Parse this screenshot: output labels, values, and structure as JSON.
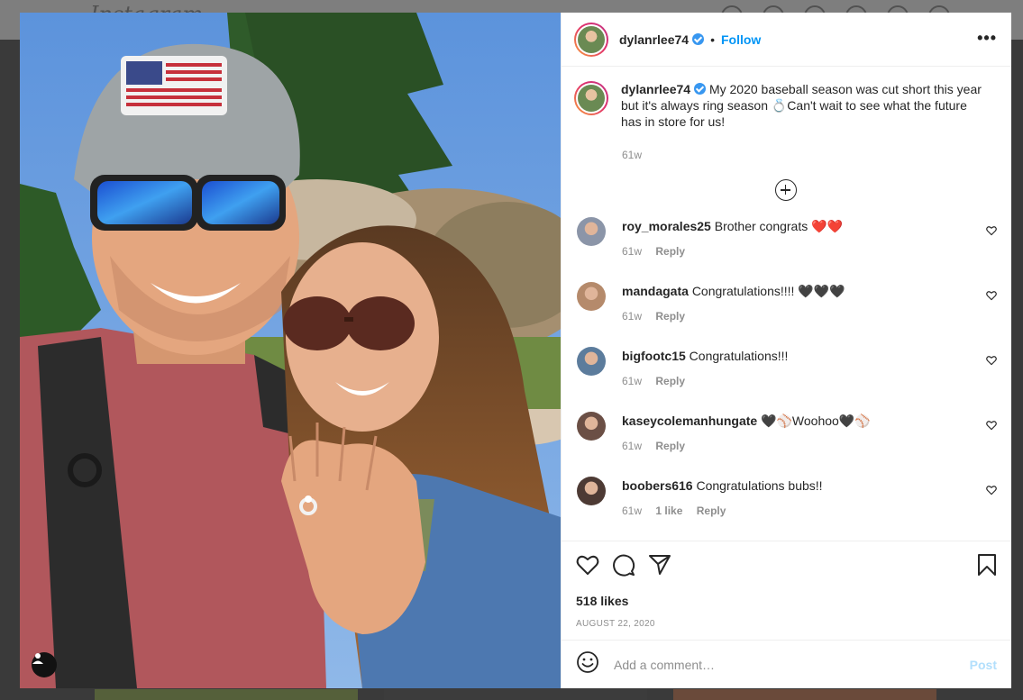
{
  "background": {
    "logo": "Instagram"
  },
  "post": {
    "author": "dylanrlee74",
    "separator": "•",
    "follow_label": "Follow",
    "more_label": "•••",
    "caption_author": "dylanrlee74",
    "caption_line1": "My 2020 baseball season was cut short this year",
    "caption_line2": "but it's always ring season 💍Can't wait to see what the future",
    "caption_line3": "has in store for us!",
    "caption_time": "61w",
    "likes": "518 likes",
    "date": "AUGUST 22, 2020"
  },
  "comments": [
    {
      "user": "roy_morales25",
      "text": "Brother congrats ❤️❤️",
      "time": "61w",
      "likes": "",
      "reply": "Reply",
      "avatar_color": "#8b95a8"
    },
    {
      "user": "mandagata",
      "text": "Congratulations!!!! 🖤🖤🖤",
      "time": "61w",
      "likes": "",
      "reply": "Reply",
      "avatar_color": "#b58a6b"
    },
    {
      "user": "bigfootc15",
      "text": "Congratulations!!!",
      "time": "61w",
      "likes": "",
      "reply": "Reply",
      "avatar_color": "#5c7c9c"
    },
    {
      "user": "kaseycolemanhungate",
      "text": "🖤⚾Woohoo🖤⚾",
      "time": "61w",
      "likes": "",
      "reply": "Reply",
      "avatar_color": "#6b4f45"
    },
    {
      "user": "boobers616",
      "text": "Congratulations bubs!!",
      "time": "61w",
      "likes": "1 like",
      "reply": "Reply",
      "avatar_color": "#4d3a34"
    }
  ],
  "composer": {
    "placeholder": "Add a comment…",
    "post_label": "Post"
  },
  "colors": {
    "link_blue": "#0095f6",
    "post_disabled": "#b2dffc",
    "muted": "#8e8e8e",
    "border": "#efefef"
  },
  "icons": [
    "heart-icon",
    "comment-icon",
    "share-icon",
    "bookmark-icon",
    "emoji-icon",
    "plus-circle-icon",
    "more-icon",
    "user-tag-icon",
    "verified-icon"
  ]
}
